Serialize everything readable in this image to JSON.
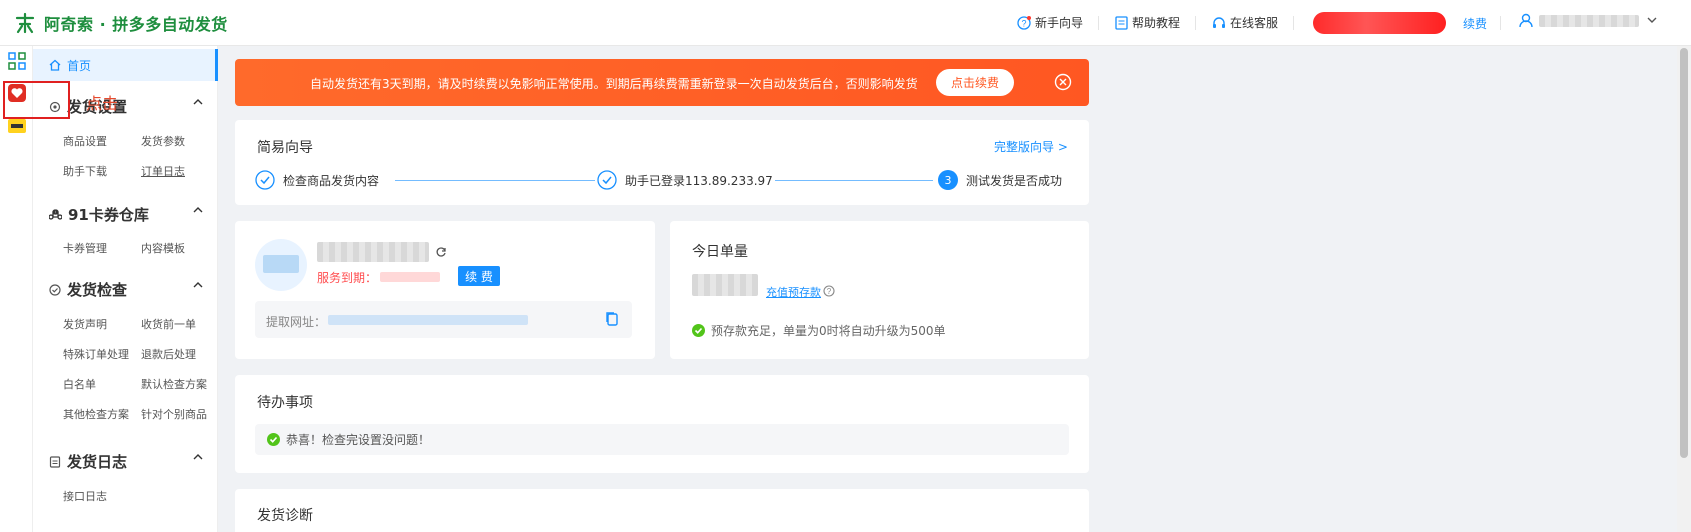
{
  "app": {
    "title": "阿奇索 · 拼多多自动发货"
  },
  "header": {
    "beginner_guide": "新手向导",
    "help": "帮助教程",
    "service": "在线客服",
    "renew": "续费"
  },
  "sidebar": {
    "home": "首页",
    "hint": "点击",
    "groups": [
      {
        "title": "发货设置",
        "items": [
          "商品设置",
          "发货参数",
          "助手下载",
          "订单日志"
        ]
      },
      {
        "title": "91卡券仓库",
        "items": [
          "卡券管理",
          "内容模板"
        ]
      },
      {
        "title": "发货检查",
        "items": [
          "发货声明",
          "收货前一单",
          "特殊订单处理",
          "退款后处理",
          "白名单",
          "默认检查方案",
          "其他检查方案",
          "针对个别商品"
        ]
      },
      {
        "title": "发货日志",
        "items": [
          "接口日志"
        ]
      }
    ]
  },
  "banner": {
    "text": "自动发货还有3天到期，请及时续费以免影响正常使用。到期后再续费需重新登录一次自动发货后台，否则影响发货",
    "button": "点击续费"
  },
  "guide": {
    "title": "简易向导",
    "full_link": "完整版向导 >",
    "steps": [
      {
        "label": "检查商品发货内容"
      },
      {
        "label": "助手已登录113.89.233.97"
      },
      {
        "num": "3",
        "label": "测试发货是否成功"
      }
    ]
  },
  "account": {
    "service_label": "服务到期：",
    "renew_button": "续 费",
    "fetch_label": "提取网址："
  },
  "today": {
    "title": "今日单量",
    "recharge": "充值预存款",
    "prestore_msg": "预存款充足，单量为0时将自动升级为500单"
  },
  "todo": {
    "title": "待办事项",
    "msg": "恭喜！检查完设置没问题！"
  },
  "diagnosis": {
    "title": "发货诊断"
  },
  "colors": {
    "primary": "#1890ff",
    "brand": "#1e8e3e",
    "warning": "#ff5722",
    "success": "#52c41a"
  }
}
